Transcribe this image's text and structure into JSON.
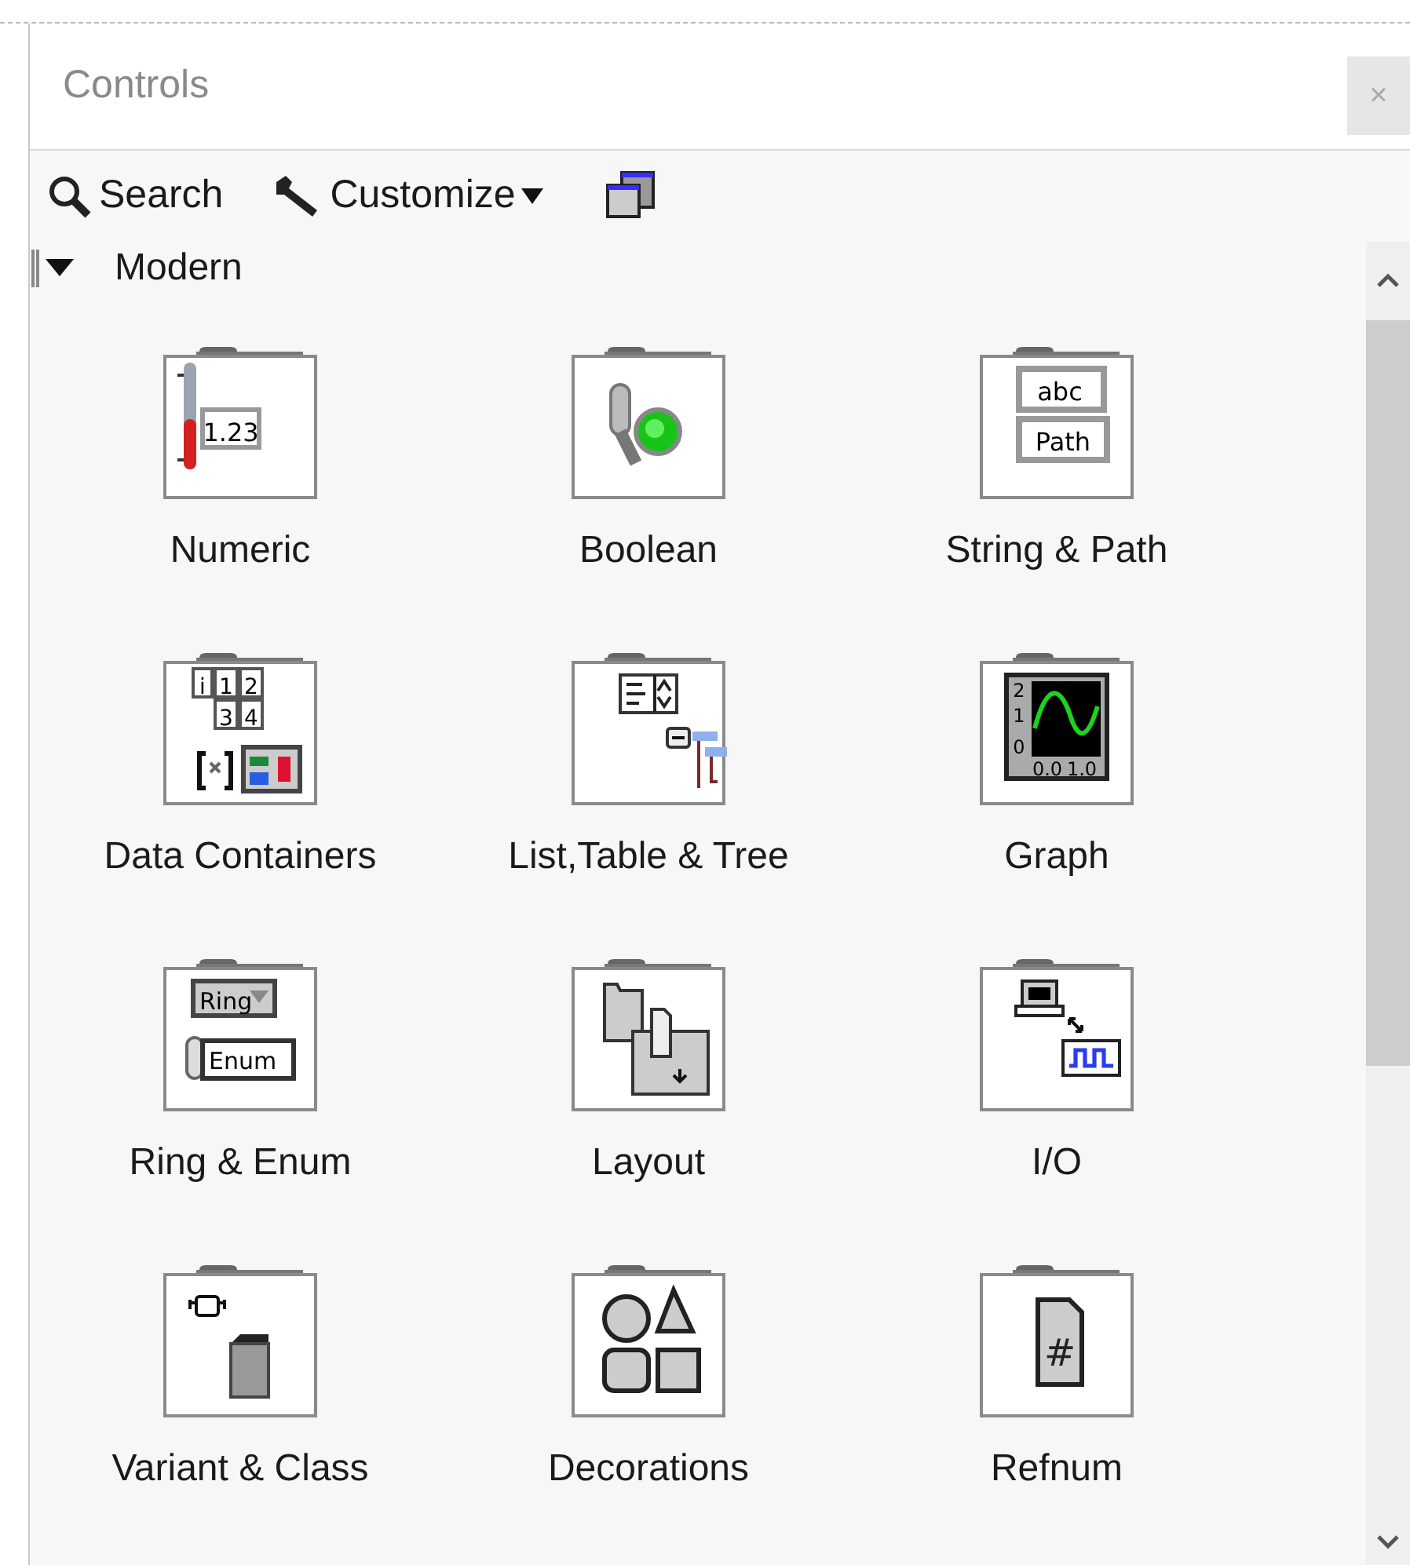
{
  "window": {
    "title": "Controls",
    "close": "×"
  },
  "toolbar": [
    {
      "kind": "search",
      "label": "Search"
    },
    {
      "kind": "customize",
      "label": "Customize"
    },
    {
      "kind": "restore"
    }
  ],
  "category": {
    "label": "Modern",
    "expanded": true
  },
  "items": [
    {
      "label": "Numeric",
      "kind": "numeric",
      "icon_text": [
        "1.23"
      ]
    },
    {
      "label": "Boolean",
      "kind": "boolean"
    },
    {
      "label": "String & Path",
      "kind": "string",
      "icon_text": [
        "abc",
        "Path"
      ]
    },
    {
      "label": "Data Containers",
      "kind": "array",
      "icon_text": [
        "i",
        "1",
        "2",
        "3",
        "4"
      ]
    },
    {
      "label": "List,Table & Tree",
      "kind": "list"
    },
    {
      "label": "Graph",
      "kind": "graph",
      "icon_text": [
        "2",
        "1",
        "0",
        "0.0",
        "1.0"
      ]
    },
    {
      "label": "Ring & Enum",
      "kind": "ring",
      "icon_text": [
        "Ring",
        "Enum"
      ]
    },
    {
      "label": "Layout",
      "kind": "layout"
    },
    {
      "label": "I/O",
      "kind": "io"
    },
    {
      "label": "Variant & Class",
      "kind": "variant"
    },
    {
      "label": "Decorations",
      "kind": "decorations"
    },
    {
      "label": "Refnum",
      "kind": "refnum",
      "icon_text": [
        "#"
      ]
    }
  ]
}
